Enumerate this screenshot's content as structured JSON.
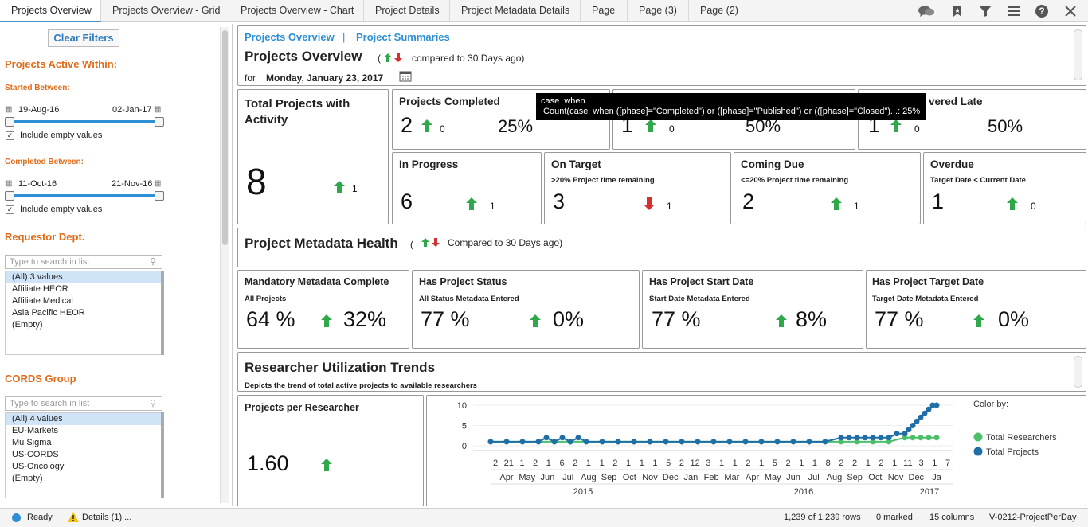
{
  "tabs": [
    {
      "label": "Projects Overview",
      "active": true
    },
    {
      "label": "Projects Overview - Grid"
    },
    {
      "label": "Projects Overview - Chart"
    },
    {
      "label": "Project Details"
    },
    {
      "label": "Project Metadata Details"
    },
    {
      "label": "Page"
    },
    {
      "label": "Page (3)"
    },
    {
      "label": "Page (2)"
    }
  ],
  "toolbar_icons": [
    "comments-icon",
    "bookmark-icon",
    "filter-icon",
    "menu-icon",
    "help-icon",
    "close-icon"
  ],
  "sidebar": {
    "clear_filters": "Clear Filters",
    "active_within": "Projects Active Within:",
    "started_between": "Started Between:",
    "started_from": "19-Aug-16",
    "started_to": "02-Jan-17",
    "include_empty_1": "Include empty values",
    "completed_between": "Completed Between:",
    "completed_from": "11-Oct-16",
    "completed_to": "21-Nov-16",
    "include_empty_2": "Include empty values",
    "requestor_dept": "Requestor Dept.",
    "search_placeholder": "Type to search in list",
    "dept_items": [
      "(All) 3 values",
      "Affiliate HEOR",
      "Affiliate Medical",
      "Asia Pacific HEOR",
      "(Empty)"
    ],
    "cords_group": "CORDS Group",
    "cords_items": [
      "(All) 4 values",
      "EU-Markets",
      "Mu Sigma",
      "US-CORDS",
      "US-Oncology",
      "(Empty)"
    ]
  },
  "header": {
    "link1": "Projects Overview",
    "sep": "|",
    "link2": "Project Summaries",
    "title": "Projects Overview",
    "paren_open": "(",
    "compared": "compared to 30 Days ago)",
    "for": "for",
    "date": "Monday, January 23, 2017"
  },
  "kpi": {
    "total_title": "Total Projects with Activity",
    "total_value": "8",
    "total_delta": "1",
    "completed_title": "Projects Completed",
    "completed_value": "2",
    "completed_delta": "0",
    "completed_pct": "25%",
    "card2_value": "1",
    "card2_delta": "0",
    "card2_pct": "50%",
    "late_title": "vered Late",
    "late_value": "1",
    "late_delta": "0",
    "late_pct": "50%",
    "inprogress_title": "In Progress",
    "inprogress_value": "6",
    "inprogress_delta": "1",
    "ontarget_title": "On Target",
    "ontarget_sub": ">20% Project time remaining",
    "ontarget_value": "3",
    "ontarget_delta": "1",
    "comingdue_title": "Coming Due",
    "comingdue_sub": "<=20% Project time remaining",
    "comingdue_value": "2",
    "comingdue_delta": "1",
    "overdue_title": "Overdue",
    "overdue_sub": "Target Date < Current Date",
    "overdue_value": "1",
    "overdue_delta": "0"
  },
  "tooltip": {
    "line1": "case  when",
    "line2": " Count(case  when ([phase]=\"Completed\") or ([phase]=\"Published\") or (([phase]=\"Closed\")...: 25%"
  },
  "metadata": {
    "title": "Project Metadata Health",
    "paren": "(",
    "compared": "Compared to 30 Days ago)",
    "cards": [
      {
        "title": "Mandatory Metadata Complete",
        "sub": "All Projects",
        "value": "64 %",
        "delta": "32%"
      },
      {
        "title": "Has Project Status",
        "sub": "All Status Metadata Entered",
        "value": "77 %",
        "delta": "0%"
      },
      {
        "title": "Has Project Start Date",
        "sub": "Start Date Metadata Entered",
        "value": "77 %",
        "delta": "8%"
      },
      {
        "title": "Has Project Target Date",
        "sub": "Target Date Metadata Entered",
        "value": "77 %",
        "delta": "0%"
      }
    ]
  },
  "trends": {
    "title": "Researcher Utilization Trends",
    "sub": "Depicts the trend of total active projects to available researchers",
    "per_researcher_title": "Projects per Researcher",
    "per_researcher_value": "1.60"
  },
  "chart_data": {
    "type": "line",
    "yticks": [
      "10",
      "5",
      "0"
    ],
    "ylim": [
      0,
      10
    ],
    "day_labels": [
      "2",
      "21",
      "1",
      "2",
      "1",
      "6",
      "2",
      "1",
      "1",
      "2",
      "1",
      "1",
      "1",
      "5",
      "2",
      "12",
      "3",
      "1",
      "1",
      "2",
      "1",
      "5",
      "2",
      "1",
      "1",
      "8",
      "2",
      "2",
      "1",
      "2",
      "1",
      "11",
      "3",
      "1",
      "7"
    ],
    "month_labels": [
      "Apr",
      "May",
      "Jun",
      "Jul",
      "Aug",
      "Sep",
      "Oct",
      "Nov",
      "Dec",
      "Jan",
      "Feb",
      "Mar",
      "Apr",
      "May",
      "Jun",
      "Jul",
      "Aug",
      "Sep",
      "Oct",
      "Nov",
      "Dec",
      "Ja"
    ],
    "year_labels": [
      "2015",
      "2016",
      "2017"
    ],
    "legend_title": "Color by:",
    "series": [
      {
        "name": "Total Researchers",
        "color": "#4cbf6a",
        "x": [
          0,
          20,
          40,
          60,
          80,
          100,
          120,
          140,
          160,
          180,
          200,
          220,
          240,
          260,
          280,
          300,
          320,
          340,
          360,
          380,
          400,
          420,
          440,
          460,
          480,
          500,
          520,
          530,
          540,
          550,
          560
        ],
        "values": [
          1,
          1,
          1,
          1,
          1,
          1,
          1,
          1,
          1,
          1,
          1,
          1,
          1,
          1,
          1,
          1,
          1,
          1,
          1,
          1,
          1,
          1,
          1,
          1,
          1,
          1,
          2,
          2,
          2,
          2,
          2
        ]
      },
      {
        "name": "Total Projects",
        "color": "#1f6fa6",
        "x": [
          0,
          20,
          40,
          60,
          70,
          80,
          90,
          100,
          110,
          120,
          140,
          160,
          180,
          200,
          220,
          240,
          260,
          280,
          300,
          320,
          340,
          360,
          380,
          400,
          420,
          440,
          450,
          460,
          470,
          480,
          490,
          500,
          510,
          520,
          525,
          530,
          535,
          540,
          545,
          550,
          555,
          560
        ],
        "values": [
          1,
          1,
          1,
          1,
          2,
          1,
          2,
          1,
          2,
          1,
          1,
          1,
          1,
          1,
          1,
          1,
          1,
          1,
          1,
          1,
          1,
          1,
          1,
          1,
          1,
          2,
          2,
          2,
          2,
          2,
          2,
          2,
          3,
          3,
          4,
          5,
          6,
          7,
          8,
          9,
          10,
          10
        ]
      }
    ]
  },
  "status": {
    "ready": "Ready",
    "details": "Details (1) ...",
    "rows": "1,239 of 1,239 rows",
    "marked": "0 marked",
    "columns": "15 columns",
    "table": "V-0212-ProjectPerDay"
  }
}
